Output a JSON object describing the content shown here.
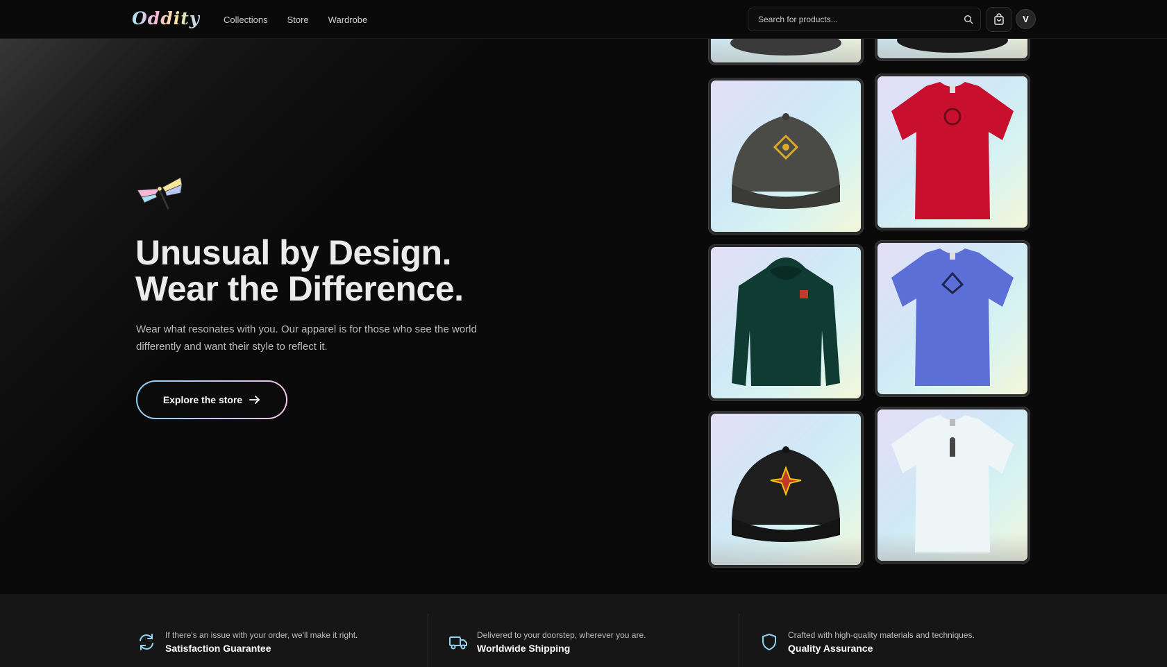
{
  "header": {
    "logo": "Oddity",
    "nav": [
      "Collections",
      "Store",
      "Wardrobe"
    ],
    "search_placeholder": "Search for products...",
    "avatar_initial": "V"
  },
  "hero": {
    "headline_line1": "Unusual by Design.",
    "headline_line2": "Wear the Difference.",
    "subtext": "Wear what resonates with you. Our apparel is for those who see the world differently and want their style to reflect it.",
    "cta_label": "Explore the store"
  },
  "products": [
    {
      "type": "cap",
      "color": "#4a4a46",
      "emblem": "diamond"
    },
    {
      "type": "tshirt",
      "color": "#c8102e",
      "emblem": "dark"
    },
    {
      "type": "hoodie",
      "color": "#0f3b33",
      "emblem": "red"
    },
    {
      "type": "tshirt",
      "color": "#5b6fd6",
      "emblem": "dark"
    },
    {
      "type": "cap",
      "color": "#1e1e1e",
      "emblem": "star"
    },
    {
      "type": "tshirt",
      "color": "#eef5f7",
      "emblem": "figure"
    }
  ],
  "features": [
    {
      "icon": "refresh-icon",
      "description": "If there's an issue with your order, we'll make it right.",
      "title": "Satisfaction Guarantee"
    },
    {
      "icon": "truck-icon",
      "description": "Delivered to your doorstep, wherever you are.",
      "title": "Worldwide Shipping"
    },
    {
      "icon": "shield-icon",
      "description": "Crafted with high-quality materials and techniques.",
      "title": "Quality Assurance"
    }
  ]
}
